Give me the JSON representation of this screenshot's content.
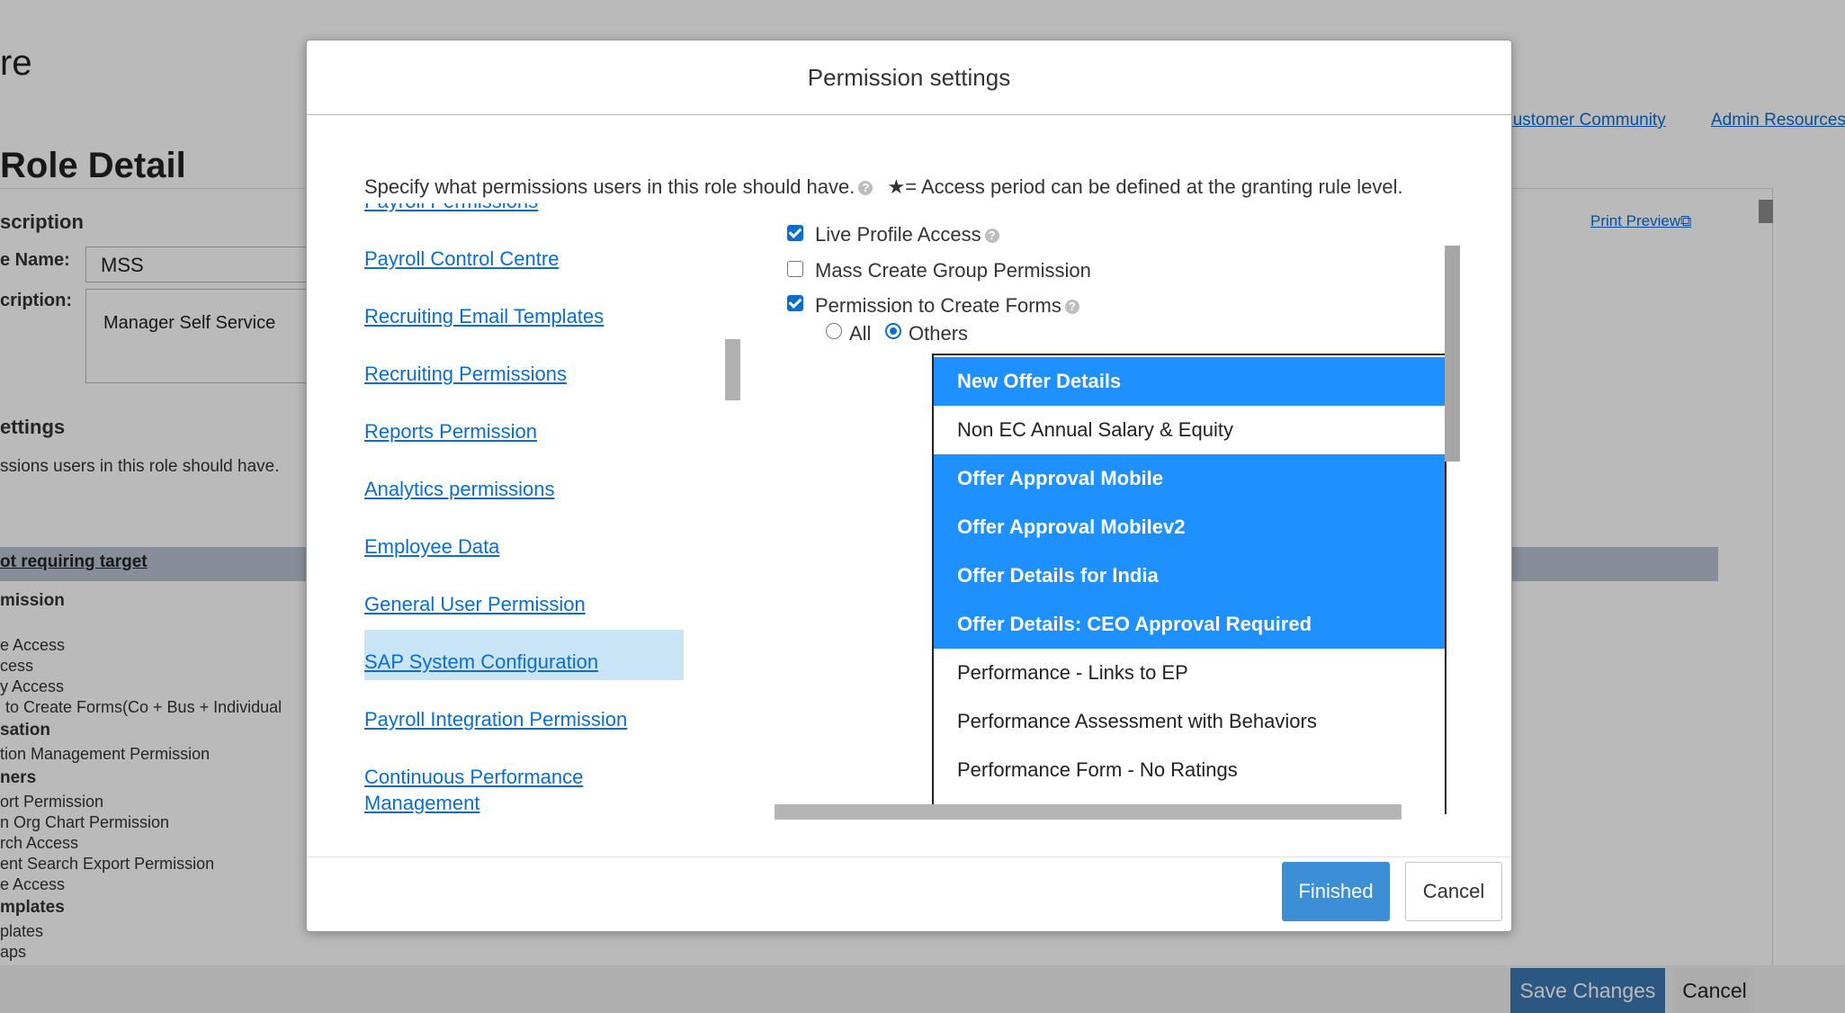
{
  "background": {
    "title_fragment": "re",
    "role_detail_heading": "Role Detail",
    "header_links": [
      "Customer Community",
      "Admin Resources"
    ],
    "description_label": "scription",
    "role_name_label": "e Name:",
    "role_name_value": "MSS",
    "description_field_label": "cription:",
    "description_value": "Manager Self Service",
    "print_preview": "Print Preview",
    "settings_heading": "ettings",
    "settings_text": "ssions users in this role should have.",
    "bar_label": "ot requiring target",
    "lines": [
      {
        "text": "mission",
        "group": true
      },
      {
        "text": "e Access",
        "group": false
      },
      {
        "text": "cess",
        "group": false
      },
      {
        "text": "y Access",
        "group": false
      },
      {
        "text": "to Create Forms(Co + Bus + Individual",
        "group": false
      },
      {
        "text": "sation",
        "group": true
      },
      {
        "text": "tion Management Permission",
        "group": false
      },
      {
        "text": "ners",
        "group": true
      },
      {
        "text": "ort Permission",
        "group": false
      },
      {
        "text": "n Org Chart Permission",
        "group": false
      },
      {
        "text": "rch Access",
        "group": false
      },
      {
        "text": "ent Search Export Permission",
        "group": false
      },
      {
        "text": "e Access",
        "group": false
      },
      {
        "text": "mplates",
        "group": true
      },
      {
        "text": "plates",
        "group": false
      },
      {
        "text": "aps",
        "group": false
      }
    ],
    "save_changes": "Save Changes",
    "cancel": "Cancel"
  },
  "dialog": {
    "title": "Permission settings",
    "intro": "Specify what permissions users in this role should have.",
    "intro_note": "★= Access period can be defined at the granting rule level.",
    "nav_items": [
      {
        "label": "Payroll Permissions",
        "selected": false
      },
      {
        "label": "Payroll Control Centre",
        "selected": false
      },
      {
        "label": "Recruiting Email Templates",
        "selected": false
      },
      {
        "label": "Recruiting Permissions",
        "selected": false
      },
      {
        "label": "Reports Permission",
        "selected": false
      },
      {
        "label": "Analytics permissions",
        "selected": false
      },
      {
        "label": "Employee Data",
        "selected": false
      },
      {
        "label": "General User Permission",
        "selected": true
      },
      {
        "label": "SAP System Configuration",
        "selected": false
      },
      {
        "label": "Payroll Integration Permission",
        "selected": false
      },
      {
        "label": "Continuous Performance Management",
        "selected": false
      }
    ],
    "permissions": [
      {
        "label": "Live Profile Access",
        "checked": true,
        "help": true
      },
      {
        "label": "Mass Create Group Permission",
        "checked": false,
        "help": false
      },
      {
        "label": "Permission to Create Forms",
        "checked": true,
        "help": true
      }
    ],
    "scope_options": [
      {
        "label": "All",
        "selected": false
      },
      {
        "label": "Others",
        "selected": true
      }
    ],
    "form_templates": [
      {
        "label": "New Offer Details",
        "selected": true
      },
      {
        "label": "Non EC Annual Salary & Equity",
        "selected": false
      },
      {
        "label": "Offer Approval Mobile",
        "selected": true
      },
      {
        "label": "Offer Approval Mobilev2",
        "selected": true
      },
      {
        "label": "Offer Details for India",
        "selected": true
      },
      {
        "label": "Offer Details: CEO Approval Required",
        "selected": true
      },
      {
        "label": "Performance - Links to EP",
        "selected": false
      },
      {
        "label": "Performance Assessment with Behaviors",
        "selected": false
      },
      {
        "label": "Performance Form - No Ratings",
        "selected": false
      }
    ],
    "finished_label": "Finished",
    "cancel_label": "Cancel"
  },
  "colors": {
    "link": "#0a6ed1",
    "selected_option": "#1e90ff",
    "selected_nav": "#c9e4f4",
    "primary_button": "#3c8fd4"
  }
}
